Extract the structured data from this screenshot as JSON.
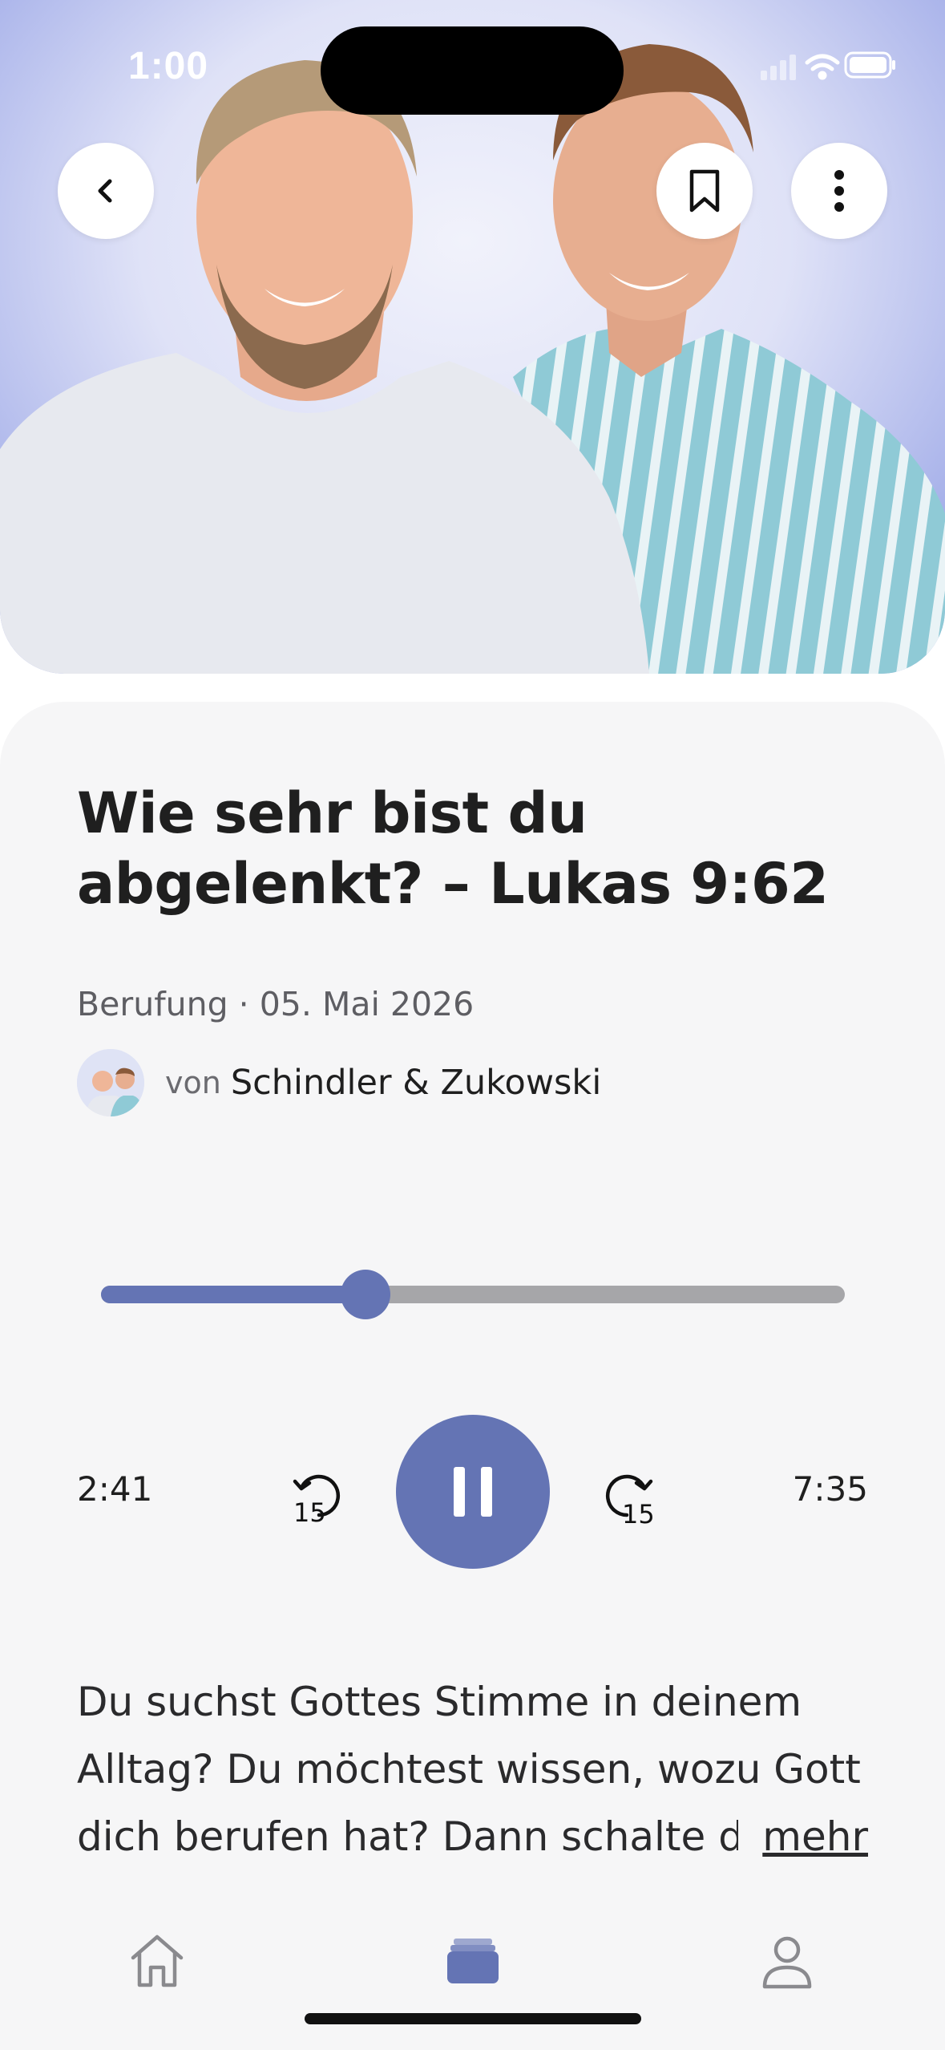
{
  "status_bar": {
    "time": "1:00"
  },
  "header": {
    "back_icon": "chevron-left-icon",
    "bookmark_icon": "bookmark-icon",
    "more_icon": "vertical-ellipsis-icon"
  },
  "episode": {
    "title": "Wie sehr bist du abgelenkt? – Lukas 9:62",
    "meta": "Berufung · 05. Mai 2026",
    "author_prefix": "von",
    "author_name": "Schindler & Zukowski",
    "description": "Du suchst Gottes Stimme in deinem Alltag? Du möchtest wissen, wozu Gott dich berufen hat? Dann schalte die",
    "more_label": "mehr"
  },
  "player": {
    "elapsed": "2:41",
    "total": "7:35",
    "progress_fraction": 0.356,
    "skip_back_seconds": "15",
    "skip_forward_seconds": "15",
    "state_icon": "pause-icon"
  },
  "tabs": [
    {
      "name": "home",
      "icon": "home-icon",
      "active": false
    },
    {
      "name": "library",
      "icon": "stack-icon",
      "active": true
    },
    {
      "name": "profile",
      "icon": "person-icon",
      "active": false
    }
  ],
  "colors": {
    "accent": "#6474b4",
    "track": "#a6a6a9",
    "card_bg": "#f6f6f7"
  }
}
